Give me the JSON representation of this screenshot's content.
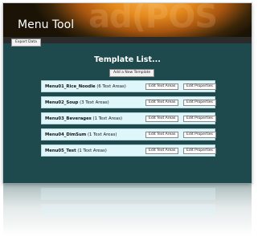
{
  "app": {
    "brand": "Menu Tool",
    "watermark": "ad(POS"
  },
  "toolbar": {
    "export_label": "Export Data"
  },
  "main": {
    "title": "Template List...",
    "add_label": "Add a New Template"
  },
  "templates": [
    {
      "name": "Menu01_Rice_Noodle",
      "areas": "(6 Text Areas)",
      "edit_text": "Edit Text Areas",
      "edit_props": "Edit Properties"
    },
    {
      "name": "Menu02_Soup",
      "areas": "(3 Text Areas)",
      "edit_text": "Edit Text Areas",
      "edit_props": "Edit Properties"
    },
    {
      "name": "Menu03_Beverages",
      "areas": "(1 Text Areas)",
      "edit_text": "Edit Text Areas",
      "edit_props": "Edit Properties"
    },
    {
      "name": "Menu04_DimSum",
      "areas": "(1 Text Areas)",
      "edit_text": "Edit Text Areas",
      "edit_props": "Edit Properties"
    },
    {
      "name": "Menu05_Test",
      "areas": "(1 Text Areas)",
      "edit_text": "Edit Text Areas",
      "edit_props": "Edit Properties"
    }
  ],
  "colors": {
    "background": "#1e4a4d",
    "header_accent": "#e58a1d",
    "row_background": "#dff6fb"
  }
}
